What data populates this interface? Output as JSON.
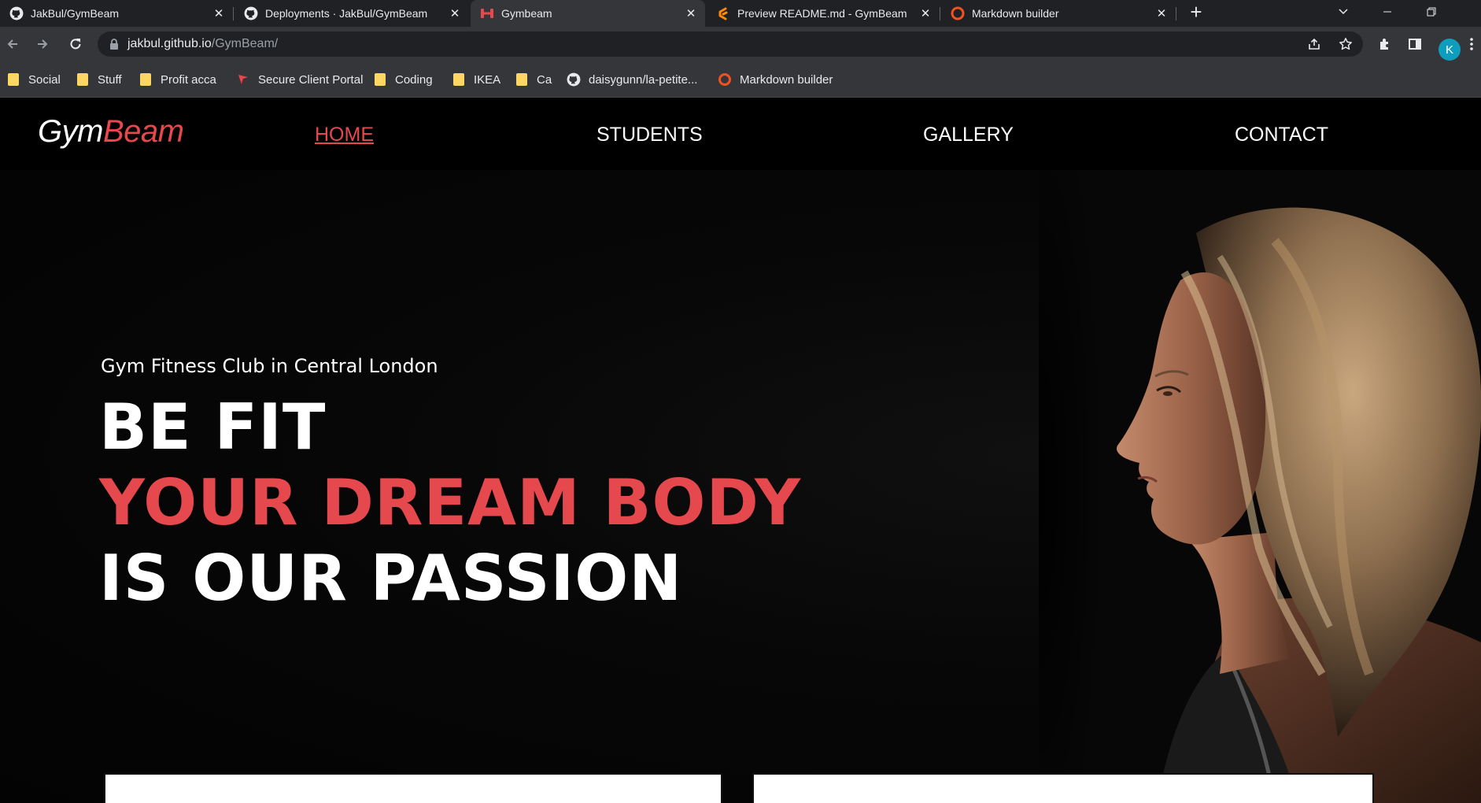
{
  "browser": {
    "tabs": [
      {
        "title": "JakBul/GymBeam",
        "icon": "github-icon",
        "active": false
      },
      {
        "title": "Deployments · JakBul/GymBeam",
        "icon": "github-icon",
        "active": false
      },
      {
        "title": "Gymbeam",
        "icon": "dumbbell-icon",
        "active": true
      },
      {
        "title": "Preview README.md - GymBeam",
        "icon": "gitpod-icon",
        "active": false
      },
      {
        "title": "Markdown builder",
        "icon": "markdown-builder-icon",
        "active": false
      }
    ],
    "address": {
      "host": "jakbul.github.io",
      "path": "/GymBeam/"
    },
    "profile_initial": "K",
    "bookmarks": [
      {
        "label": "Social",
        "icon": "folder-icon"
      },
      {
        "label": "Stuff",
        "icon": "folder-icon"
      },
      {
        "label": "Profit acca",
        "icon": "folder-icon"
      },
      {
        "label": "Secure Client Portal",
        "icon": "portal-icon"
      },
      {
        "label": "Coding",
        "icon": "folder-icon"
      },
      {
        "label": "IKEA",
        "icon": "folder-icon"
      },
      {
        "label": "Ca",
        "icon": "folder-icon"
      },
      {
        "label": "daisygunn/la-petite...",
        "icon": "github-icon"
      },
      {
        "label": "Markdown builder",
        "icon": "markdown-builder-icon"
      }
    ]
  },
  "site": {
    "logo": {
      "part1": "Gym",
      "part2": "Beam"
    },
    "nav": [
      {
        "label": "HOME",
        "current": true
      },
      {
        "label": "STUDENTS",
        "current": false
      },
      {
        "label": "GALLERY",
        "current": false
      },
      {
        "label": "CONTACT",
        "current": false
      }
    ],
    "hero": {
      "tagline": "Gym Fitness Club in Central London",
      "line1": "BE FIT",
      "line2": "YOUR DREAM BODY",
      "line3": "IS OUR PASSION"
    },
    "colors": {
      "accent": "#e5484d",
      "background": "#050505",
      "text": "#ffffff"
    }
  }
}
